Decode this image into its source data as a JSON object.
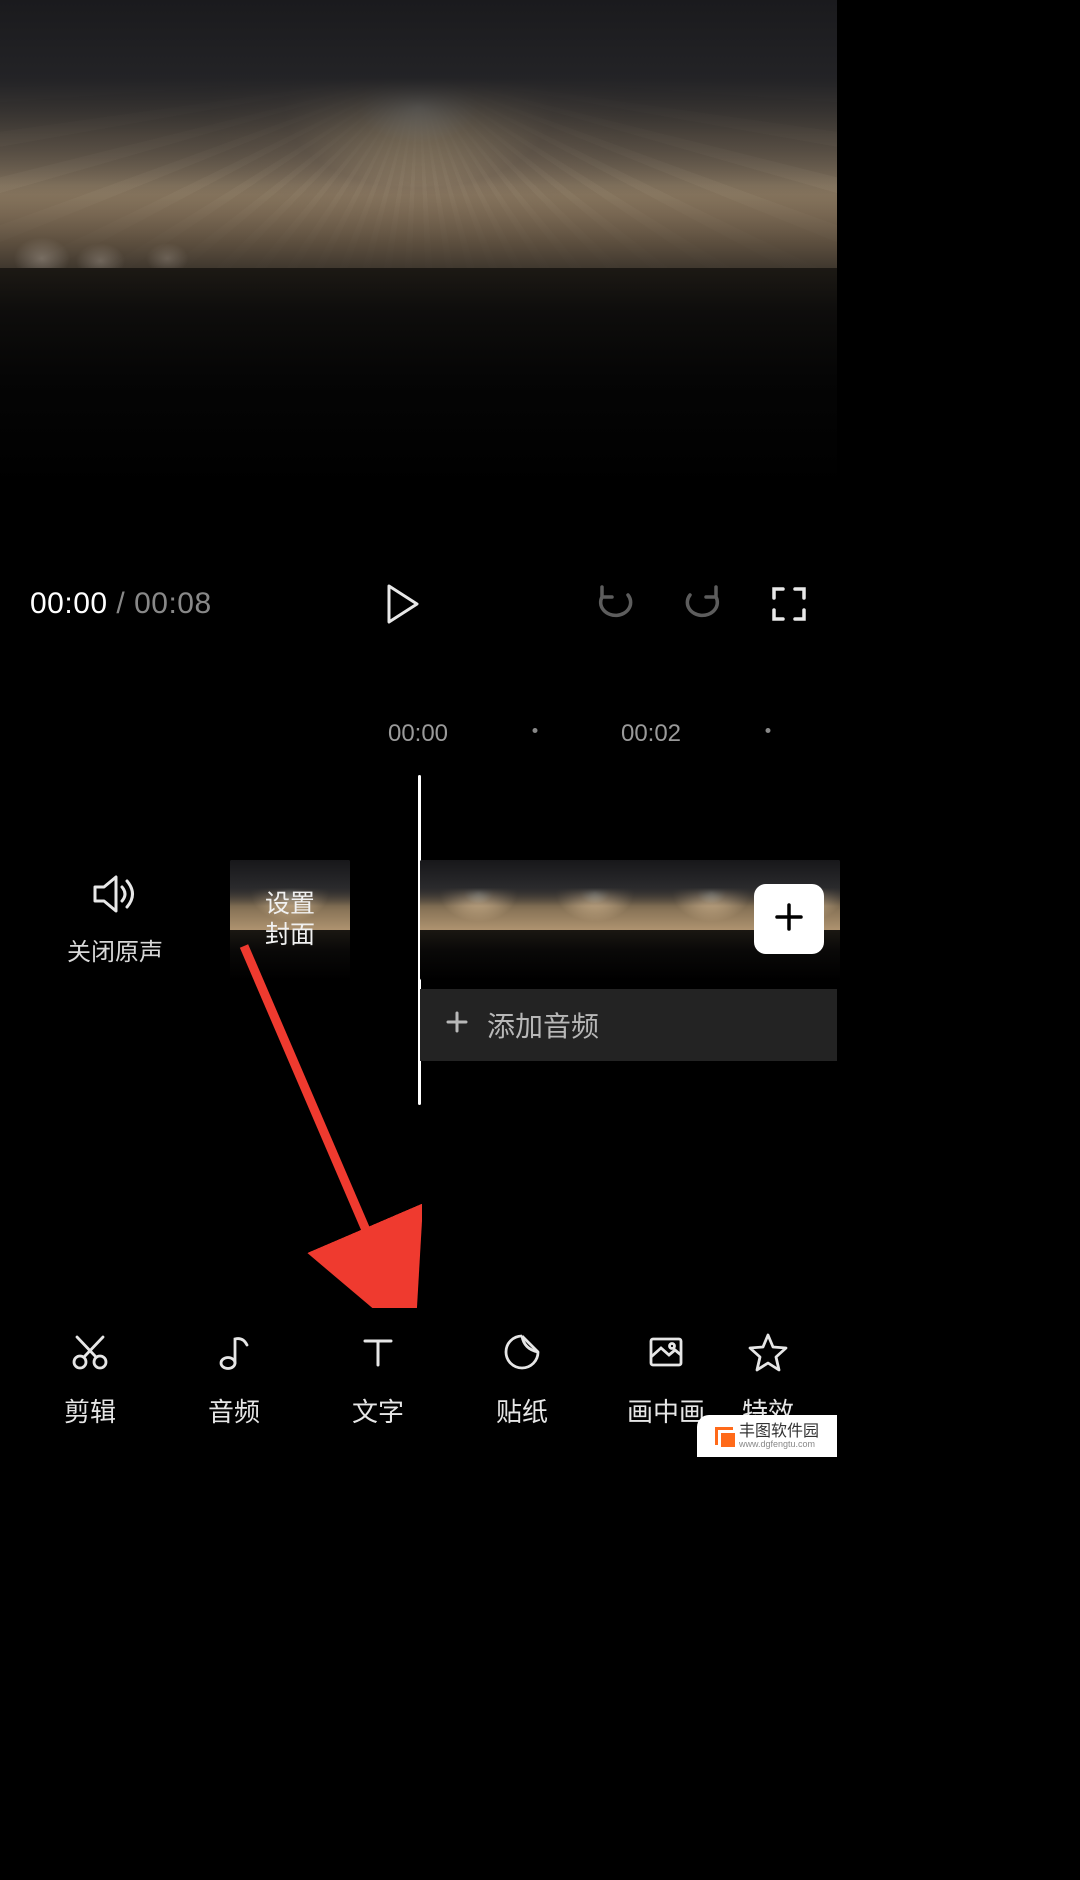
{
  "playback": {
    "current": "00:00",
    "separator": " / ",
    "total": "00:08"
  },
  "ruler": {
    "mark0": "00:00",
    "mark2": "00:02"
  },
  "timeline": {
    "mute_label": "关闭原声",
    "cover_line1": "设置",
    "cover_line2": "封面",
    "add_audio": "添加音频"
  },
  "tools": {
    "edit": "剪辑",
    "audio": "音频",
    "text": "文字",
    "sticker": "贴纸",
    "pip": "画中画",
    "effect": "特效"
  },
  "watermark": {
    "title": "丰图软件园",
    "url": "www.dgfengtu.com"
  }
}
